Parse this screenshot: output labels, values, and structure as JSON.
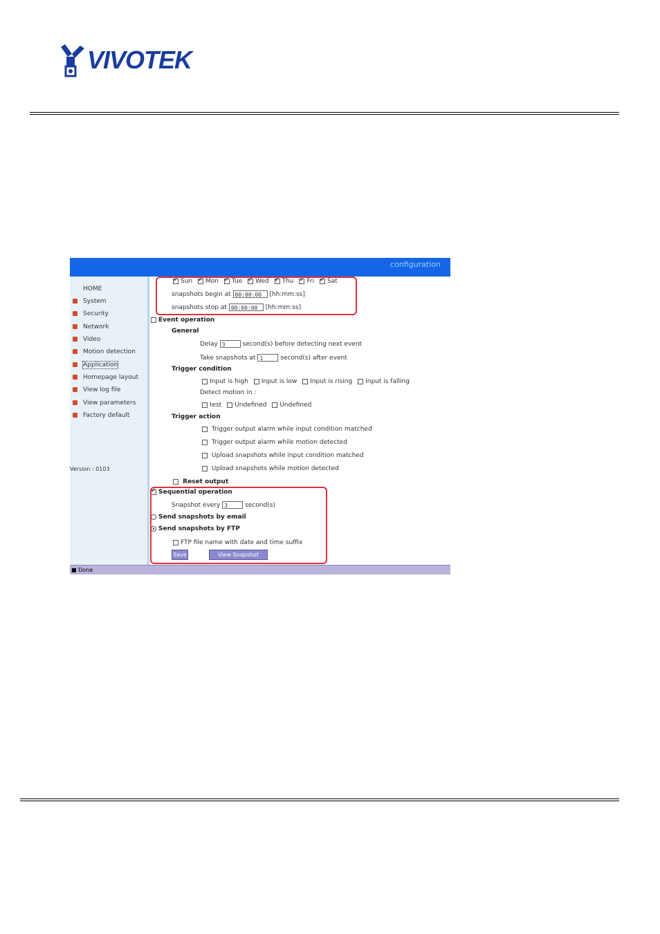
{
  "logo": {
    "text": "VIVOTEK"
  },
  "app": {
    "title": "configuration",
    "status": "Done",
    "version": "Version : 0103"
  },
  "sidebar": {
    "home": "HOME",
    "items": [
      {
        "label": "System"
      },
      {
        "label": "Security"
      },
      {
        "label": "Network"
      },
      {
        "label": "Video"
      },
      {
        "label": "Motion detection"
      },
      {
        "label": "Application"
      },
      {
        "label": "Homepage layout"
      },
      {
        "label": "View log file"
      },
      {
        "label": "View parameters"
      },
      {
        "label": "Factory default"
      }
    ]
  },
  "schedule": {
    "days": [
      {
        "label": "Sun",
        "checked": true
      },
      {
        "label": "Mon",
        "checked": true
      },
      {
        "label": "Tue",
        "checked": true
      },
      {
        "label": "Wed",
        "checked": true
      },
      {
        "label": "Thu",
        "checked": true
      },
      {
        "label": "Fri",
        "checked": true
      },
      {
        "label": "Sat",
        "checked": true
      }
    ],
    "begin_label": "snapshots begin at",
    "begin_value": "00:00:00",
    "stop_label": "snapshots stop at",
    "stop_value": "00:00:00",
    "time_format": "[hh:mm:ss]"
  },
  "event": {
    "label": "Event operation",
    "general": "General",
    "delay_label": "Delay",
    "delay_value": "3",
    "delay_suffix": "second(s) before detecting next event",
    "take_label": "Take snapshots at",
    "take_value": "1",
    "take_suffix": "second(s) after event",
    "trigger_condition": "Trigger condition",
    "conditions": [
      "Input is high",
      "Input is low",
      "Input is rising",
      "Input is falling"
    ],
    "detect_label": "Detect motion in :",
    "motion_windows": [
      "test",
      "Undefined",
      "Undefined"
    ],
    "trigger_action": "Trigger action",
    "actions": [
      "Trigger output alarm while input condition matched",
      "Trigger output alarm while motion detected",
      "Upload snapshots while input condition matched",
      "Upload snapshots while motion detected"
    ],
    "reset_output": "Reset output"
  },
  "sequential": {
    "label": "Sequential operation",
    "every_label": "Snapshot every",
    "every_value": "3",
    "every_suffix": "second(s)",
    "email_label": "Send snapshots by email",
    "ftp_label": "Send snapshots by FTP",
    "ftp_suffix_label": "FTP file name with date and time suffix",
    "save_label": "Save",
    "view_label": "View Snapshot"
  },
  "colors": {
    "topbar": "#1466e6",
    "highlight": "#e0303a",
    "sidebar": "#e9f1f8",
    "button": "#8a8ad0"
  }
}
